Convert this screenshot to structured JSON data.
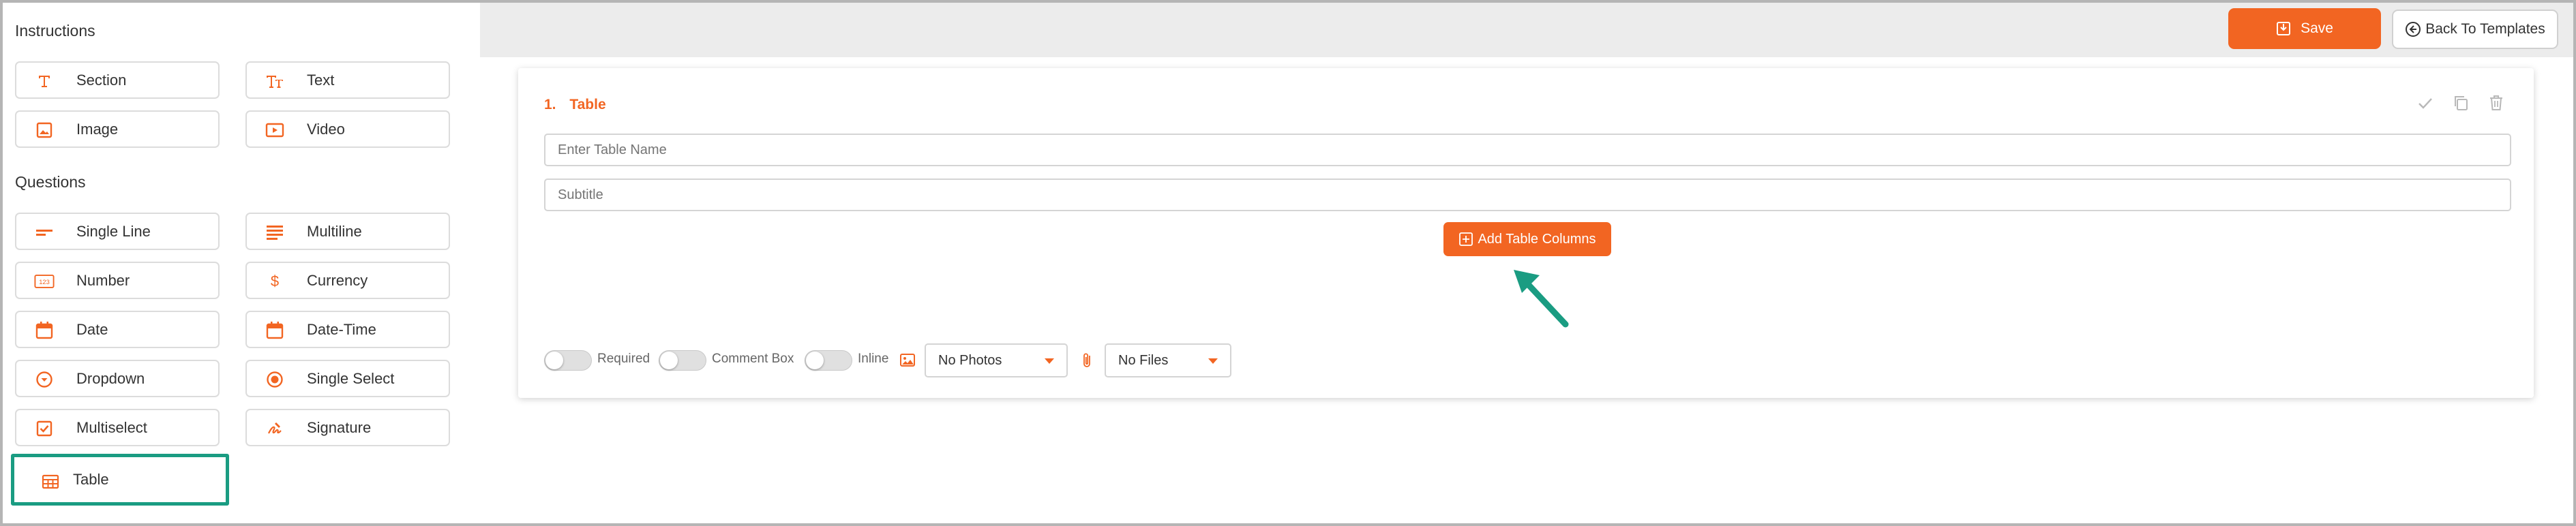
{
  "sidebar": {
    "instructions_heading": "Instructions",
    "questions_heading": "Questions",
    "instructions": [
      {
        "label": "Section",
        "icon": "section-icon"
      },
      {
        "label": "Text",
        "icon": "text-icon"
      },
      {
        "label": "Image",
        "icon": "image-icon"
      },
      {
        "label": "Video",
        "icon": "video-icon"
      }
    ],
    "questions": [
      {
        "label": "Single Line",
        "icon": "single-line-icon"
      },
      {
        "label": "Multiline",
        "icon": "multiline-icon"
      },
      {
        "label": "Number",
        "icon": "number-icon"
      },
      {
        "label": "Currency",
        "icon": "currency-icon"
      },
      {
        "label": "Date",
        "icon": "calendar-icon"
      },
      {
        "label": "Date-Time",
        "icon": "calendar-icon"
      },
      {
        "label": "Dropdown",
        "icon": "dropdown-icon"
      },
      {
        "label": "Single Select",
        "icon": "radio-icon"
      },
      {
        "label": "Multiselect",
        "icon": "checkbox-icon"
      },
      {
        "label": "Signature",
        "icon": "signature-icon"
      },
      {
        "label": "Table",
        "icon": "table-icon",
        "selected": true
      }
    ]
  },
  "toolbar": {
    "save_label": "Save",
    "back_label": "Back To Templates"
  },
  "question": {
    "number": "1.",
    "title": "Table",
    "table_name_placeholder": "Enter Table Name",
    "subtitle_placeholder": "Subtitle",
    "add_columns_label": "Add Table Columns",
    "required_label": "Required",
    "comment_box_label": "Comment Box",
    "inline_label": "Inline",
    "photos_value": "No Photos",
    "files_value": "No Files"
  },
  "colors": {
    "accent": "#f26522",
    "highlight": "#1a9c82",
    "topbar": "#ececec"
  }
}
